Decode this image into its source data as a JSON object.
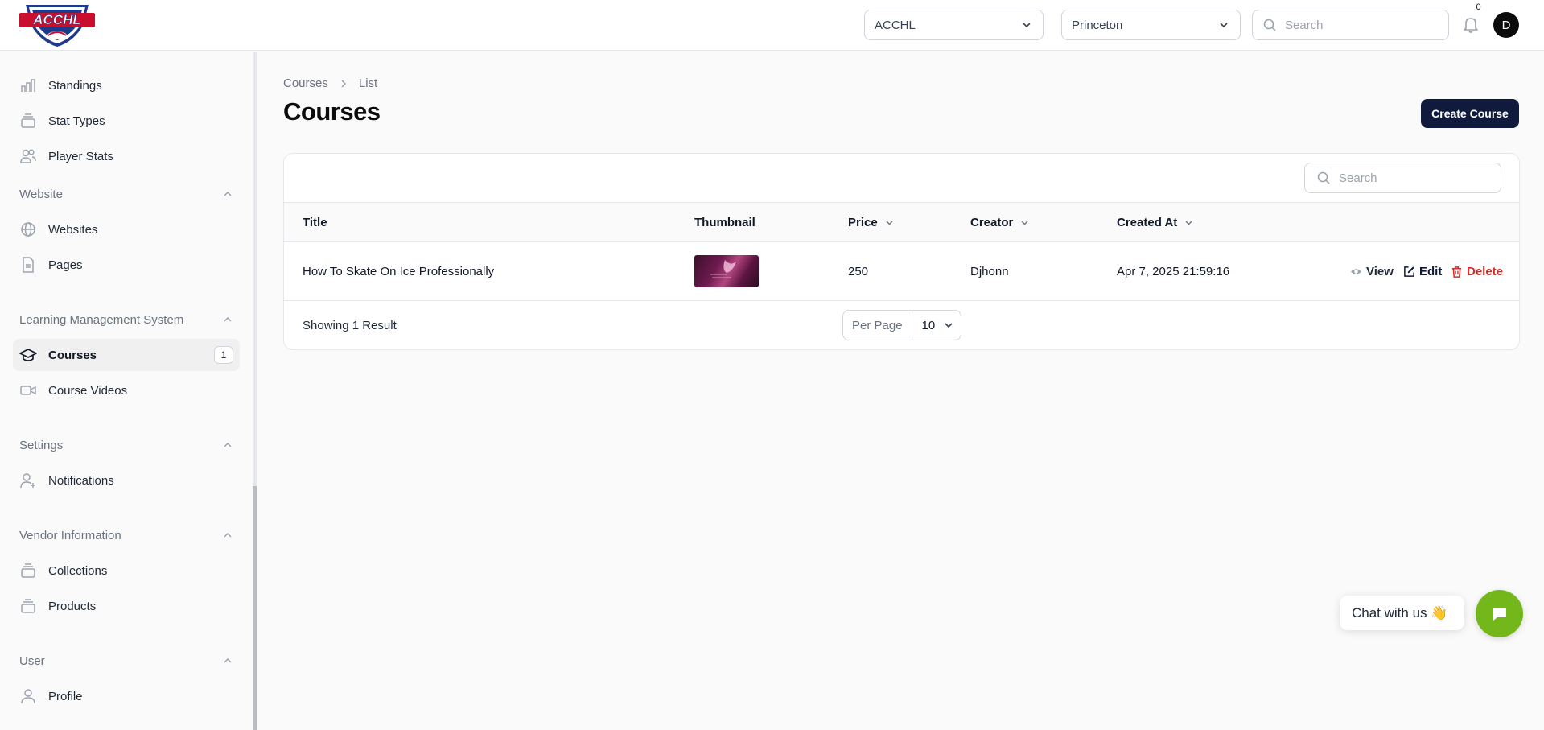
{
  "header": {
    "logo_text": "ACCHL",
    "league_select": "ACCHL",
    "team_select": "Princeton",
    "search_placeholder": "Search",
    "notification_count": "0",
    "avatar_initial": "D"
  },
  "sidebar": {
    "items_top": [
      {
        "label": "Standings",
        "icon": "bar-chart-icon"
      },
      {
        "label": "Stat Types",
        "icon": "stack-icon"
      },
      {
        "label": "Player Stats",
        "icon": "users-icon"
      }
    ],
    "groups": [
      {
        "label": "Website",
        "items": [
          {
            "label": "Websites",
            "icon": "globe-icon"
          },
          {
            "label": "Pages",
            "icon": "document-icon"
          }
        ]
      },
      {
        "label": "Learning Management System",
        "items": [
          {
            "label": "Courses",
            "icon": "graduation-cap-icon",
            "count": "1"
          },
          {
            "label": "Course Videos",
            "icon": "video-camera-icon"
          }
        ]
      },
      {
        "label": "Settings",
        "items": [
          {
            "label": "Notifications",
            "icon": "user-plus-icon"
          }
        ]
      },
      {
        "label": "Vendor Information",
        "items": [
          {
            "label": "Collections",
            "icon": "stack-icon"
          },
          {
            "label": "Products",
            "icon": "stack-icon"
          }
        ]
      },
      {
        "label": "User",
        "items": [
          {
            "label": "Profile",
            "icon": "user-icon"
          }
        ]
      }
    ]
  },
  "main": {
    "breadcrumb": [
      "Courses",
      "List"
    ],
    "title": "Courses",
    "create_button": "Create Course",
    "table_search_placeholder": "Search",
    "columns": [
      "Title",
      "Thumbnail",
      "Price",
      "Creator",
      "Created At"
    ],
    "rows": [
      {
        "title": "How To Skate On Ice Professionally",
        "price": "250",
        "creator": "Djhonn",
        "created_at": "Apr 7, 2025 21:59:16"
      }
    ],
    "actions": {
      "view": "View",
      "edit": "Edit",
      "delete": "Delete"
    },
    "footer": {
      "showing": "Showing 1 Result",
      "per_page_label": "Per Page",
      "per_page_value": "10"
    }
  },
  "chat": {
    "label": "Chat with us 👋"
  },
  "colors": {
    "accent": "#0f1a3d",
    "danger": "#dc2626",
    "chat": "#74b71b"
  }
}
